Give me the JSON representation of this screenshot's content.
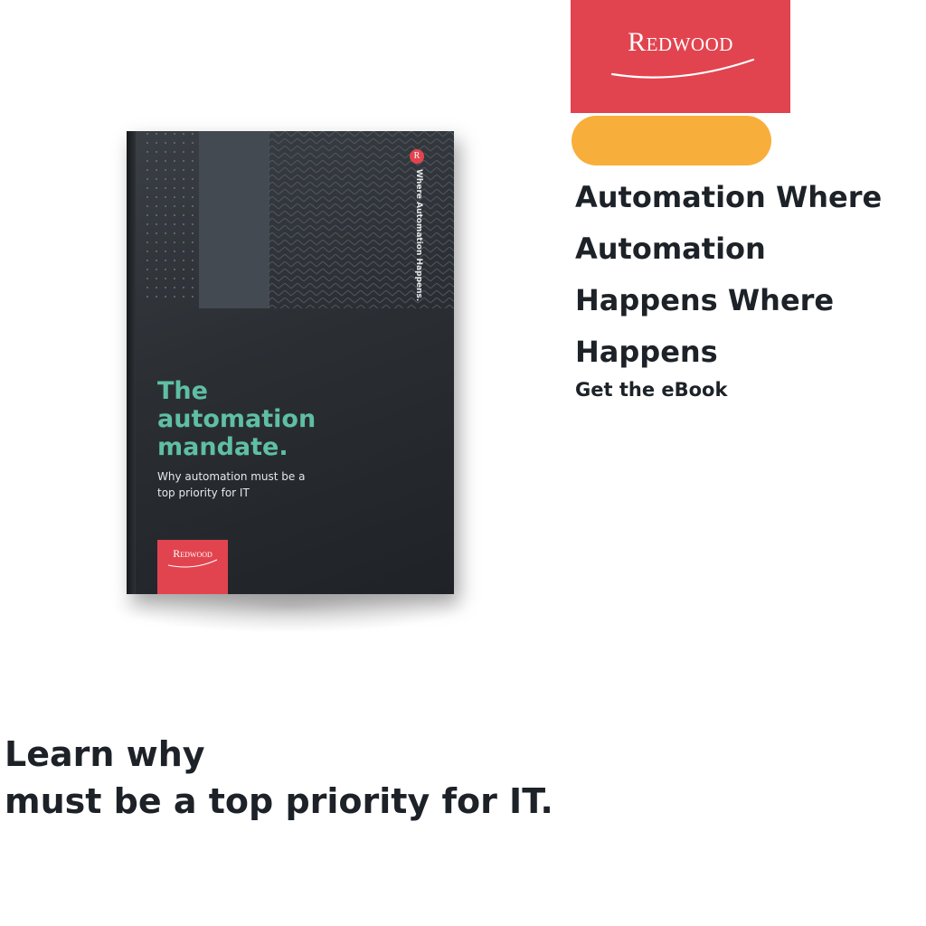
{
  "brand": {
    "logo_text": "Redwood",
    "colors": {
      "red": "#e2444f",
      "orange": "#f8ae3b",
      "teal": "#5fbfa3",
      "dark": "#1d2228"
    }
  },
  "headline": [
    "Automation Where",
    "Automation",
    "Happens Where",
    "Happens"
  ],
  "cta": "Get the eBook",
  "book": {
    "title": [
      "The",
      "automation",
      "mandate."
    ],
    "subtitle": [
      "Why automation must be a",
      "top priority for IT"
    ],
    "tagline": "Where Automation Happens.",
    "logo_text": "Redwood",
    "badge": "R"
  },
  "bottom_text": [
    "Learn why",
    "must be a top priority for IT."
  ]
}
